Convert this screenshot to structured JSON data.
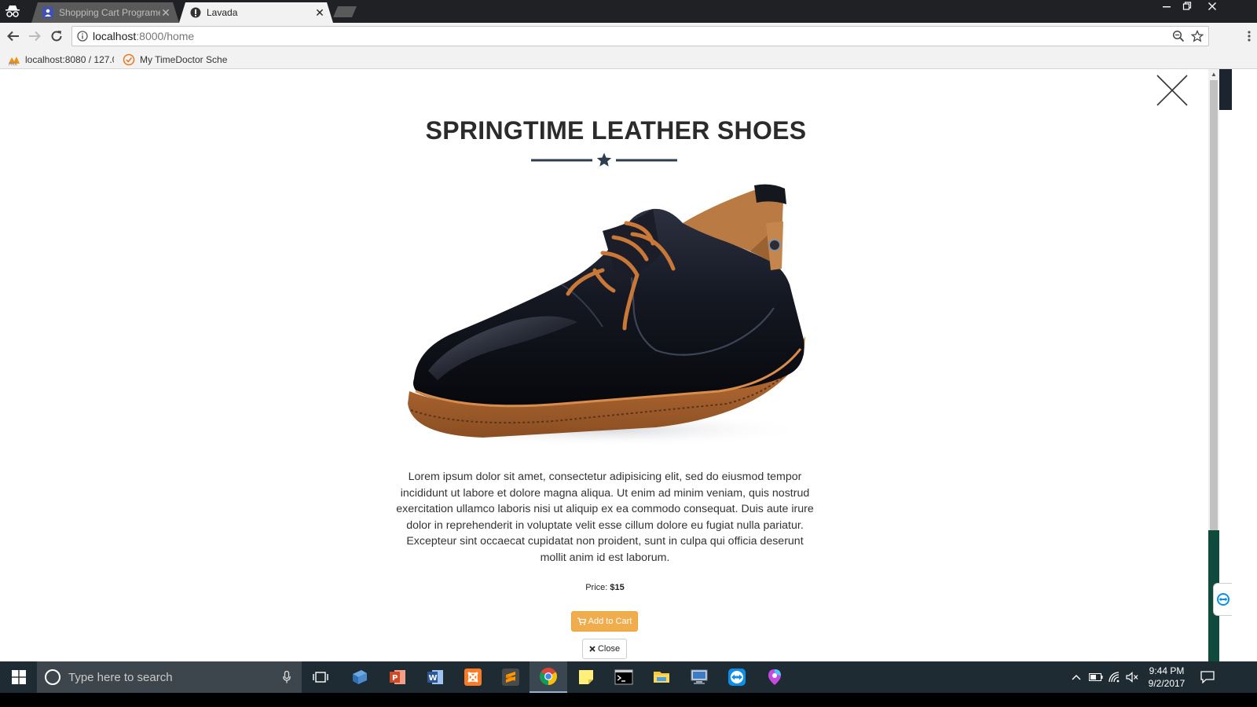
{
  "browser": {
    "tabs": [
      {
        "title": "Shopping Cart Programe",
        "state": "inactive"
      },
      {
        "title": "Lavada",
        "state": "active"
      }
    ],
    "address": {
      "host": "localhost",
      "path": ":8000/home"
    },
    "bookmarks": [
      {
        "label": "localhost:8080 / 127.0"
      },
      {
        "label": "My TimeDoctor Sche"
      }
    ]
  },
  "product": {
    "title": "SPRINGTIME LEATHER SHOES",
    "description": "Lorem ipsum dolor sit amet, consectetur adipisicing elit, sed do eiusmod tempor incididunt ut labore et dolore magna aliqua. Ut enim ad minim veniam, quis nostrud exercitation ullamco laboris nisi ut aliquip ex ea commodo consequat. Duis aute irure dolor in reprehenderit in voluptate velit esse cillum dolore eu fugiat nulla pariatur. Excepteur sint occaecat cupidatat non proident, sunt in culpa qui officia deserunt mollit anim id est laborum.",
    "price_label": "Price:",
    "price_value": "$15",
    "add_to_cart_label": "Add to Cart",
    "close_label": "Close"
  },
  "taskbar": {
    "search_placeholder": "Type here to search",
    "time": "9:44 PM",
    "date": "9/2/2017"
  },
  "colors": {
    "accent_orange": "#f0ad4e",
    "title_dark": "#2b2b2b",
    "divider_navy": "#2c3e50",
    "taskbar_bg": "#1f2b33"
  }
}
